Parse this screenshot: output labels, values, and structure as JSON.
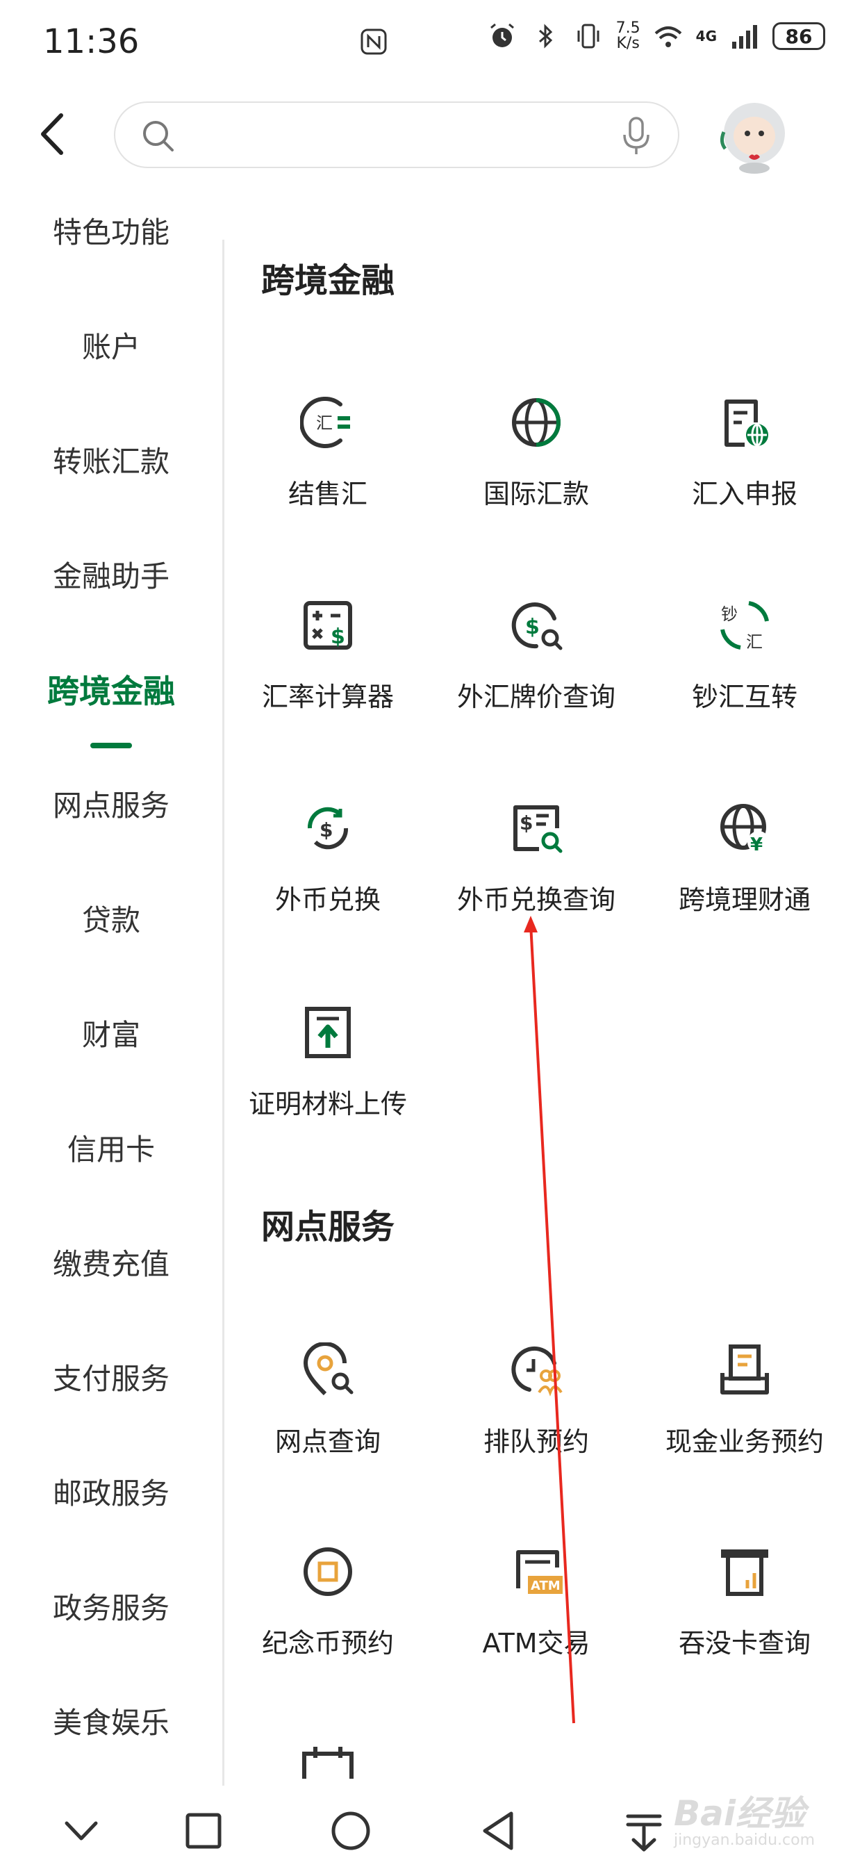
{
  "status_bar": {
    "time": "11:36",
    "net_speed_value": "7.5",
    "net_speed_unit": "K/s",
    "battery": "86",
    "network": "4G"
  },
  "header": {
    "search_placeholder": ""
  },
  "sidebar": {
    "items": [
      {
        "label": "特色功能"
      },
      {
        "label": "账户"
      },
      {
        "label": "转账汇款"
      },
      {
        "label": "金融助手"
      },
      {
        "label": "跨境金融",
        "active": true
      },
      {
        "label": "网点服务"
      },
      {
        "label": "贷款"
      },
      {
        "label": "财富"
      },
      {
        "label": "信用卡"
      },
      {
        "label": "缴费充值"
      },
      {
        "label": "支付服务"
      },
      {
        "label": "邮政服务"
      },
      {
        "label": "政务服务"
      },
      {
        "label": "美食娱乐"
      }
    ]
  },
  "sections": [
    {
      "title": "跨境金融",
      "tiles": [
        {
          "label": "结售汇",
          "icon": "exchange-settlement-icon"
        },
        {
          "label": "国际汇款",
          "icon": "globe-icon"
        },
        {
          "label": "汇入申报",
          "icon": "inward-declaration-icon"
        },
        {
          "label": "汇率计算器",
          "icon": "calculator-icon"
        },
        {
          "label": "外汇牌价查询",
          "icon": "fx-rate-search-icon"
        },
        {
          "label": "钞汇互转",
          "icon": "cash-exchange-icon"
        },
        {
          "label": "外币兑换",
          "icon": "currency-exchange-icon"
        },
        {
          "label": "外币兑换查询",
          "icon": "exchange-query-icon"
        },
        {
          "label": "跨境理财通",
          "icon": "cross-border-wealth-icon"
        },
        {
          "label": "证明材料上传",
          "icon": "upload-icon"
        }
      ]
    },
    {
      "title": "网点服务",
      "tiles": [
        {
          "label": "网点查询",
          "icon": "branch-search-icon"
        },
        {
          "label": "排队预约",
          "icon": "queue-booking-icon"
        },
        {
          "label": "现金业务预约",
          "icon": "cash-service-icon"
        },
        {
          "label": "纪念币预约",
          "icon": "commemorative-coin-icon"
        },
        {
          "label": "ATM交易",
          "icon": "atm-icon"
        },
        {
          "label": "吞没卡查询",
          "icon": "card-swallowed-icon"
        }
      ]
    }
  ],
  "watermark": {
    "main": "Bai经验",
    "sub": "jingyan.baidu.com"
  },
  "colors": {
    "accent": "#007a3d",
    "icon_dark": "#333333",
    "icon_orange": "#e8a33c"
  }
}
